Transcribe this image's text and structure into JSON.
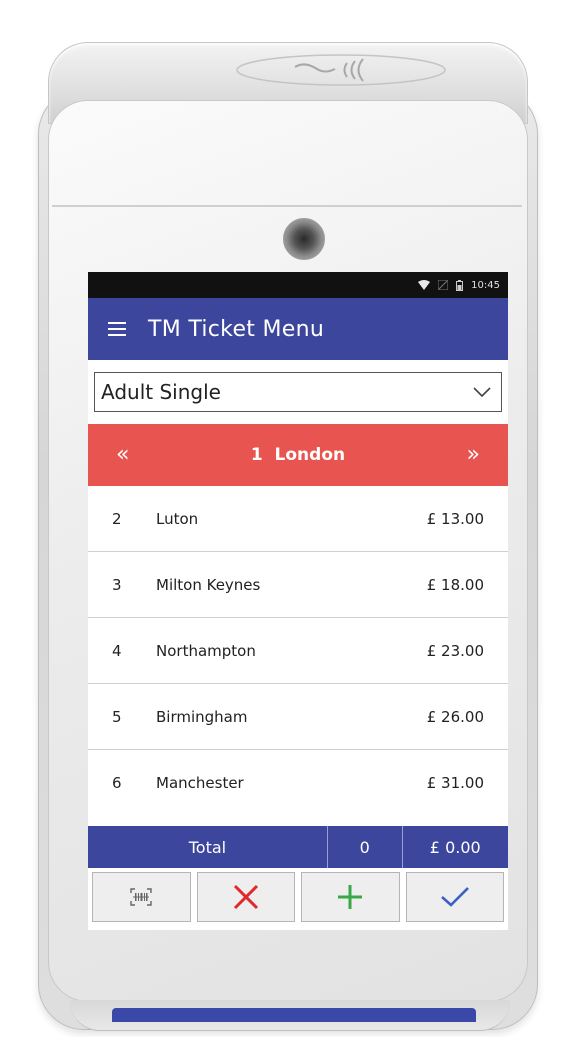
{
  "status_bar": {
    "time": "10:45",
    "icons": [
      "wifi-icon",
      "signal-icon",
      "battery-icon"
    ]
  },
  "app_bar": {
    "title": "TM Ticket Menu",
    "menu_icon": "hamburger-menu-icon"
  },
  "ticket_type": {
    "selected": "Adult Single",
    "icon": "chevron-down-icon"
  },
  "origin": {
    "label": "1  London",
    "prev_icon": "double-chevron-left-icon",
    "next_icon": "double-chevron-right-icon"
  },
  "stops": [
    {
      "num": "2",
      "name": "Luton",
      "price": "£ 13.00"
    },
    {
      "num": "3",
      "name": "Milton Keynes",
      "price": "£ 18.00"
    },
    {
      "num": "4",
      "name": "Northampton",
      "price": "£ 23.00"
    },
    {
      "num": "5",
      "name": "Birmingham",
      "price": "£ 26.00"
    },
    {
      "num": "6",
      "name": "Manchester",
      "price": "£ 31.00"
    }
  ],
  "total": {
    "label": "Total",
    "count": "0",
    "amount": "£ 0.00"
  },
  "actions": [
    {
      "icon": "barcode-scan-icon"
    },
    {
      "icon": "cancel-x-icon"
    },
    {
      "icon": "add-plus-icon"
    },
    {
      "icon": "confirm-check-icon"
    }
  ],
  "colors": {
    "app_bar": "#3b469c",
    "origin_bar": "#e85550",
    "cancel": "#e02a2a",
    "add": "#3aa845",
    "confirm": "#3b5fc4"
  }
}
